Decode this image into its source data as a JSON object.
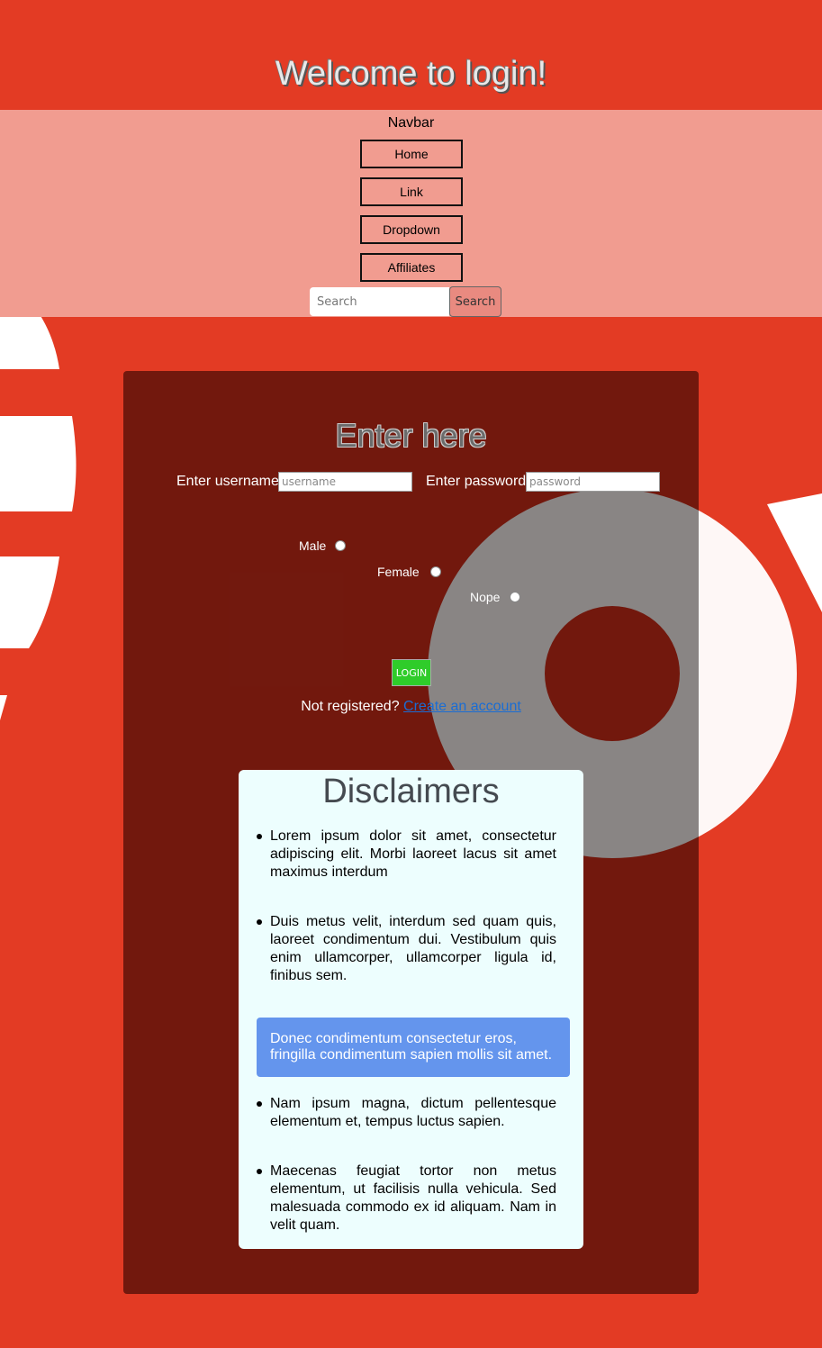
{
  "header": {
    "title": "Welcome to login!"
  },
  "navbar": {
    "title": "Navbar",
    "items": [
      "Home",
      "Link",
      "Dropdown",
      "Affiliates"
    ],
    "search": {
      "placeholder": "Search",
      "button_label": "Search"
    }
  },
  "login": {
    "heading": "Enter here",
    "username_label": "Enter username:",
    "username_placeholder": "username",
    "password_label": "Enter password:",
    "password_placeholder": "password",
    "genders": [
      "Male",
      "Female",
      "Nope"
    ],
    "submit_label": "LOGIN",
    "register_text": "Not registered?",
    "register_link": "Create an account"
  },
  "disclaimers": {
    "title": "Disclaimers",
    "items": [
      "Lorem ipsum dolor sit amet, consectetur adipiscing elit. Morbi laoreet lacus sit amet maximus interdum",
      "Duis metus velit, interdum sed quam quis, laoreet condimentum dui. Vestibulum quis enim ullamcorper, ullamcorper ligula id, finibus sem.",
      "Nam ipsum magna, dictum pellentesque elementum et, tempus luctus sapien.",
      "Maecenas feugiat tortor non metus elementum, ut facilisis nulla vehicula. Sed malesuada commodo ex id aliquam. Nam in velit quam."
    ],
    "highlight": "Donec condimentum consectetur eros, fringilla condimentum sapien mollis sit amet."
  },
  "colors": {
    "background": "#e33b24",
    "navbar": "#f19c90",
    "panel": "#69160c",
    "login_button": "#2fcc2a",
    "highlight": "#6495ed",
    "disclaimer_card": "#edfefe"
  }
}
